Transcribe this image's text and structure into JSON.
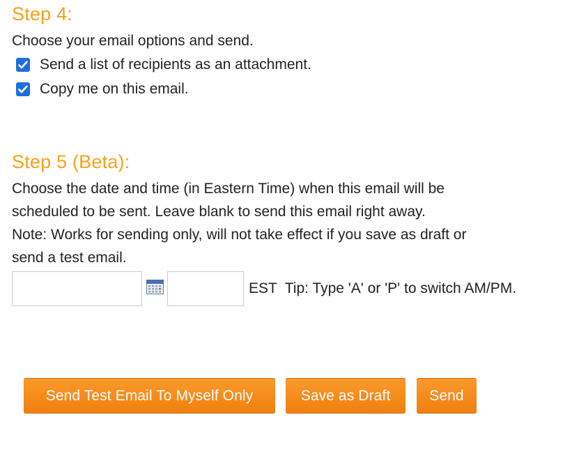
{
  "step4": {
    "title": "Step 4:",
    "description": "Choose your email options and send.",
    "options": [
      {
        "label": "Send a list of recipients as an attachment.",
        "checked": true
      },
      {
        "label": "Copy me on this email.",
        "checked": true
      }
    ]
  },
  "step5": {
    "title": "Step 5 (Beta):",
    "description_lines": [
      "Choose the date and time (in Eastern Time) when this email will be",
      "scheduled to be sent. Leave blank to send this email right away.",
      "Note: Works for sending only, will not take effect if you save as draft or",
      "send a test email."
    ],
    "date_value": "",
    "time_value": "",
    "calendar_icon": "calendar-icon",
    "timezone_tip": "EST  Tip: Type 'A' or 'P' to switch AM/PM."
  },
  "buttons": {
    "test_label": "Send Test Email To Myself Only",
    "draft_label": "Save as Draft",
    "send_label": "Send"
  },
  "colors": {
    "heading": "#f7a11a",
    "button": "#f58a1f",
    "checkbox": "#1e6fd9"
  }
}
